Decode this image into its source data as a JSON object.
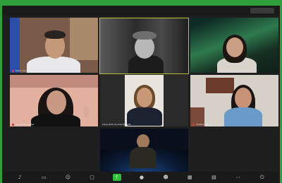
{
  "participants": [
    {
      "name": "Mario Landa Rojas"
    },
    {
      "name": ""
    },
    {
      "name": ""
    },
    {
      "name": "Kenya Hernández"
    },
    {
      "name": "Laura Ruth Arreola Estrada"
    },
    {
      "name": "Cristina Téllez"
    },
    {
      "name": ""
    }
  ],
  "toolbar": {
    "icons": [
      "audio-icon",
      "video-icon",
      "participants-icon",
      "chat-icon",
      "share-icon",
      "record-icon",
      "reactions-icon",
      "apps-icon",
      "whiteboard-icon",
      "more-icon",
      "leave-icon"
    ]
  },
  "colors": {
    "outer_green": "#2e9f3a",
    "active_speaker": "#b9c43a",
    "share_green": "#2fbd3a"
  }
}
